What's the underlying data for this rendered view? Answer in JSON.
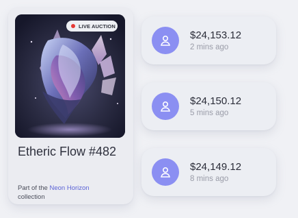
{
  "nft": {
    "badge_label": "LIVE AUCTION",
    "title": "Etheric Flow #482",
    "collection_prefix": "Part of the",
    "collection_name": "Neon Horizon",
    "collection_suffix": "collection"
  },
  "bids": [
    {
      "amount": "$24,153.12",
      "time": "2 mins ago",
      "icon": "user-icon"
    },
    {
      "amount": "$24,150.12",
      "time": "5 mins ago",
      "icon": "user-icon"
    },
    {
      "amount": "$24,149.12",
      "time": "8 mins ago",
      "icon": "user-icon"
    }
  ],
  "colors": {
    "accent": "#8b8ff2",
    "link": "#5b63d6",
    "live": "#e53935",
    "background": "#f0f1f5"
  }
}
